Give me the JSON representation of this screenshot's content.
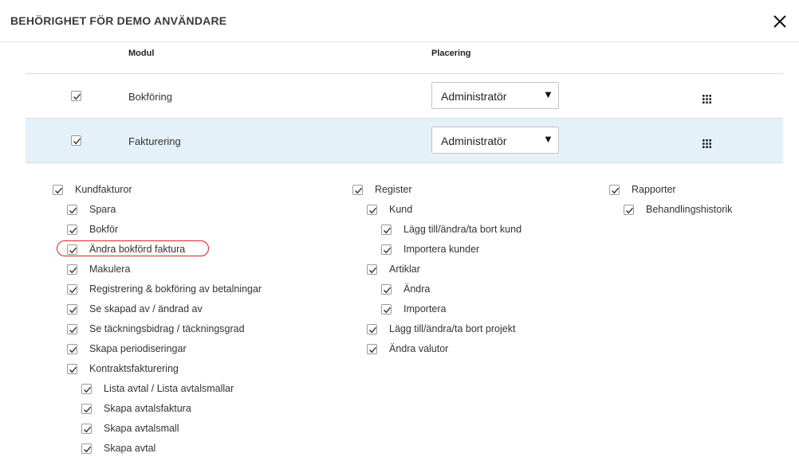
{
  "dialog": {
    "title": "BEHÖRIGHET FÖR DEMO ANVÄNDARE"
  },
  "table": {
    "col_module": "Modul",
    "col_placement": "Placering",
    "rows": [
      {
        "label": "Bokföring",
        "role": "Administratör",
        "checked": true,
        "highlighted": false
      },
      {
        "label": "Fakturering",
        "role": "Administratör",
        "checked": true,
        "highlighted": true
      }
    ]
  },
  "permissions": {
    "col1": [
      {
        "label": "Kundfakturor",
        "level": 0
      },
      {
        "label": "Spara",
        "level": 1
      },
      {
        "label": "Bokför",
        "level": 1
      },
      {
        "label": "Ändra bokförd faktura",
        "level": 1
      },
      {
        "label": "Makulera",
        "level": 1
      },
      {
        "label": "Registrering & bokföring av betalningar",
        "level": 1
      },
      {
        "label": "Se skapad av / ändrad av",
        "level": 1
      },
      {
        "label": "Se täckningsbidrag / täckningsgrad",
        "level": 1
      },
      {
        "label": "Skapa periodiseringar",
        "level": 1
      },
      {
        "label": "Kontraktsfakturering",
        "level": 1
      },
      {
        "label": "Lista avtal / Lista avtalsmallar",
        "level": 2
      },
      {
        "label": "Skapa avtalsfaktura",
        "level": 2
      },
      {
        "label": "Skapa avtalsmall",
        "level": 2
      },
      {
        "label": "Skapa avtal",
        "level": 2
      }
    ],
    "col2": [
      {
        "label": "Register",
        "level": 0
      },
      {
        "label": "Kund",
        "level": 1
      },
      {
        "label": "Lägg till/ändra/ta bort kund",
        "level": 2
      },
      {
        "label": "Importera kunder",
        "level": 2
      },
      {
        "label": "Artiklar",
        "level": 1
      },
      {
        "label": "Ändra",
        "level": 2
      },
      {
        "label": "Importera",
        "level": 2
      },
      {
        "label": "Lägg till/ändra/ta bort projekt",
        "level": 1
      },
      {
        "label": "Ändra valutor",
        "level": 1
      }
    ],
    "col3": [
      {
        "label": "Rapporter",
        "level": 0
      },
      {
        "label": "Behandlingshistorik",
        "level": 1
      }
    ]
  },
  "colors": {
    "row_highlight": "#e5f1f9",
    "annotation": "#e02020"
  },
  "icons": {
    "close": "close-icon",
    "checkbox": "checkmark-icon",
    "drag": "grid-dots-icon"
  }
}
